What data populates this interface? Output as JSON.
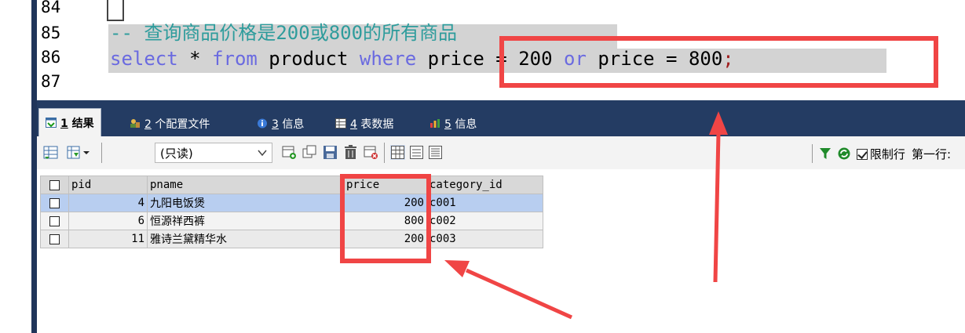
{
  "editor": {
    "line_numbers": [
      "84",
      "85",
      "86",
      "87"
    ],
    "comment_line": "-- 查询商品价格是200或800的所有商品",
    "sql": {
      "kw_select": "select",
      "star": " * ",
      "kw_from": "from",
      "table": " product ",
      "kw_where": "where",
      "cond1": " price = 200 ",
      "kw_or": "or",
      "cond2": " price = 800",
      "semicolon": ";"
    }
  },
  "tabs": [
    {
      "num": "1",
      "label": "结果",
      "icon": "result-grid-icon",
      "active": true
    },
    {
      "num": "2",
      "label": "个配置文件",
      "icon": "profile-icon",
      "active": false
    },
    {
      "num": "3",
      "label": "信息",
      "icon": "info-icon",
      "active": false
    },
    {
      "num": "4",
      "label": "表数据",
      "icon": "table-data-icon",
      "active": false
    },
    {
      "num": "5",
      "label": "信息",
      "icon": "info-chart-icon",
      "active": false
    }
  ],
  "toolbar": {
    "mode_select": "(只读)",
    "limit_rows_label": "限制行",
    "first_row_label": "第一行:"
  },
  "grid": {
    "columns": [
      "pid",
      "pname",
      "price",
      "category_id"
    ],
    "rows": [
      {
        "pid": "4",
        "pname": "九阳电饭煲",
        "price": "200",
        "category_id": "c001"
      },
      {
        "pid": "6",
        "pname": "恒源祥西裤",
        "price": "800",
        "category_id": "c002"
      },
      {
        "pid": "11",
        "pname": "雅诗兰黛精华水",
        "price": "200",
        "category_id": "c003"
      }
    ]
  },
  "colors": {
    "annotation_red": "#f04545",
    "tabbar_bg": "#243c63",
    "comment": "#2e9c9c",
    "keyword": "#6a6ae0",
    "selected_row": "#b8cef0"
  }
}
